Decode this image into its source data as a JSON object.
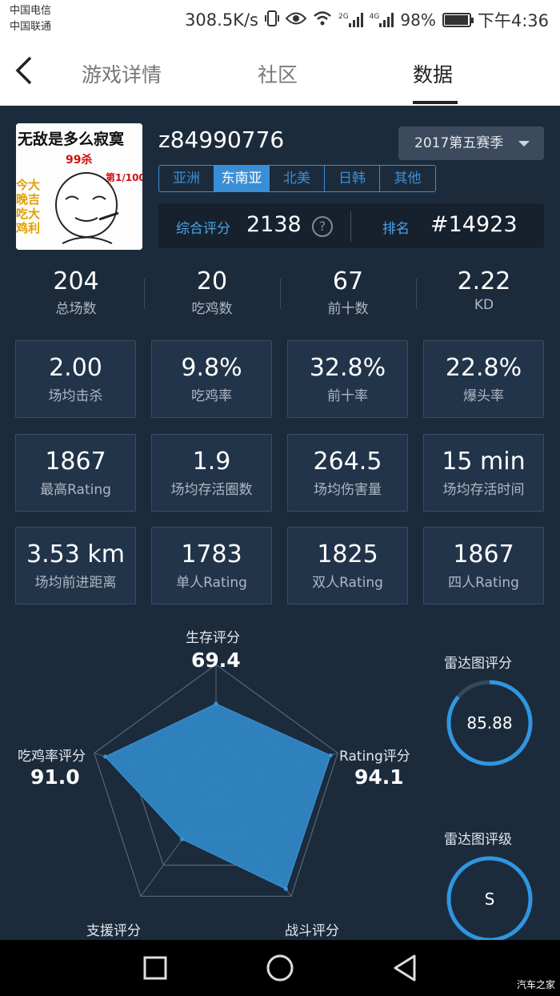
{
  "status_bar": {
    "carrier1": "中国电信",
    "carrier2": "中国联通",
    "net_speed": "308.5K/s",
    "net_2g": "2G",
    "net_4g": "4G",
    "battery": "98%",
    "battery_level": 0.98,
    "time": "下午4:36"
  },
  "nav": {
    "tabs": [
      {
        "label": "游戏详情",
        "active": false
      },
      {
        "label": "社区",
        "active": false
      },
      {
        "label": "数据",
        "active": true
      }
    ]
  },
  "profile": {
    "avatar_text": {
      "line1": "无敌是多么寂寞",
      "kills": "99杀",
      "rank": "第1/100",
      "side": [
        "今大",
        "晚吉",
        "吃大",
        "鸡利"
      ]
    },
    "username": "z84990776",
    "season": "2017第五赛季",
    "regions": [
      {
        "label": "亚洲",
        "active": false
      },
      {
        "label": "东南亚",
        "active": true
      },
      {
        "label": "北美",
        "active": false
      },
      {
        "label": "日韩",
        "active": false
      },
      {
        "label": "其他",
        "active": false
      }
    ],
    "score_label": "综合评分",
    "score_value": "2138",
    "help_glyph": "?",
    "rank_label": "排名",
    "rank_value": "#14923"
  },
  "top_stats": [
    {
      "value": "204",
      "label": "总场数"
    },
    {
      "value": "20",
      "label": "吃鸡数"
    },
    {
      "value": "67",
      "label": "前十数"
    },
    {
      "value": "2.22",
      "label": "KD"
    }
  ],
  "grid": [
    {
      "value": "2.00",
      "label": "场均击杀"
    },
    {
      "value": "9.8%",
      "label": "吃鸡率"
    },
    {
      "value": "32.8%",
      "label": "前十率"
    },
    {
      "value": "22.8%",
      "label": "爆头率"
    },
    {
      "value": "1867",
      "label": "最高Rating"
    },
    {
      "value": "1.9",
      "label": "场均存活圈数"
    },
    {
      "value": "264.5",
      "label": "场均伤害量"
    },
    {
      "value": "15 min",
      "label": "场均存活时间"
    },
    {
      "value": "3.53 km",
      "label": "场均前进距离"
    },
    {
      "value": "1783",
      "label": "单人Rating"
    },
    {
      "value": "1825",
      "label": "双人Rating"
    },
    {
      "value": "1867",
      "label": "四人Rating"
    }
  ],
  "radar": {
    "axes": [
      {
        "label": "生存评分",
        "value": "69.4",
        "score": 69.4
      },
      {
        "label": "Rating评分",
        "value": "94.1",
        "score": 94.1
      },
      {
        "label": "战斗评分",
        "value": "",
        "score": 93
      },
      {
        "label": "支援评分",
        "value": "",
        "score": 45
      },
      {
        "label": "吃鸡率评分",
        "value": "91.0",
        "score": 91.0
      }
    ],
    "max": 100,
    "fill_color": "#2f86c4"
  },
  "side_scores": {
    "radar_score_label": "雷达图评分",
    "radar_score_value": "85.88",
    "radar_score_fraction": 0.8588,
    "radar_grade_label": "雷达图评级",
    "radar_grade_value": "S",
    "ring_color": "#2f96e0"
  },
  "bottom_nav": {
    "watermark": "汽车之家"
  }
}
